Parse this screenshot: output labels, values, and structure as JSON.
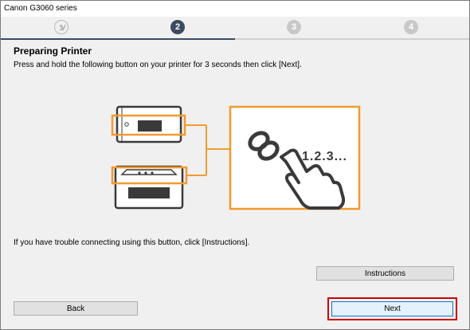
{
  "window": {
    "title": "Canon G3060 series"
  },
  "steps": [
    {
      "label": "1",
      "state": "done"
    },
    {
      "label": "2",
      "state": "active"
    },
    {
      "label": "3",
      "state": "todo"
    },
    {
      "label": "4",
      "state": "todo"
    }
  ],
  "main": {
    "heading": "Preparing Printer",
    "instruction": "Press and hold the following button on your printer for 3 seconds then click [Next].",
    "illustration_text": "1.2.3...",
    "trouble_text": "If you have trouble connecting using this button, click [Instructions]."
  },
  "buttons": {
    "instructions": "Instructions",
    "back": "Back",
    "next": "Next"
  },
  "colors": {
    "accent_orange": "#f39a2e",
    "step_active": "#3c4a62",
    "step_todo": "#c8c8c8",
    "highlight_red": "#d10000"
  }
}
